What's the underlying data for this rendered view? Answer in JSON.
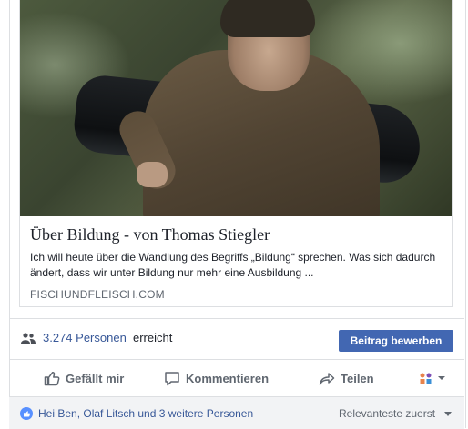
{
  "link_preview": {
    "title": "Über Bildung - von Thomas Stiegler",
    "description": "Ich will heute über die Wandlung des Begriffs „Bildung“ sprechen. Was sich dadurch ändert, dass wir unter Bildung nur mehr eine Ausbildung ...",
    "domain": "FISCHUNDFLEISCH.COM"
  },
  "reach": {
    "count": "3.274 Personen",
    "suffix": "erreicht",
    "boost_label": "Beitrag bewerben",
    "icon": "people-icon"
  },
  "actions": {
    "like": "Gefällt mir",
    "comment": "Kommentieren",
    "share": "Teilen"
  },
  "reactors": {
    "text": "Hei Ben, Olaf Litsch und 3 weitere Personen",
    "sort": "Relevanteste zuerst"
  },
  "colors": {
    "brand": "#4267b2",
    "link": "#385898",
    "muted": "#606770"
  }
}
